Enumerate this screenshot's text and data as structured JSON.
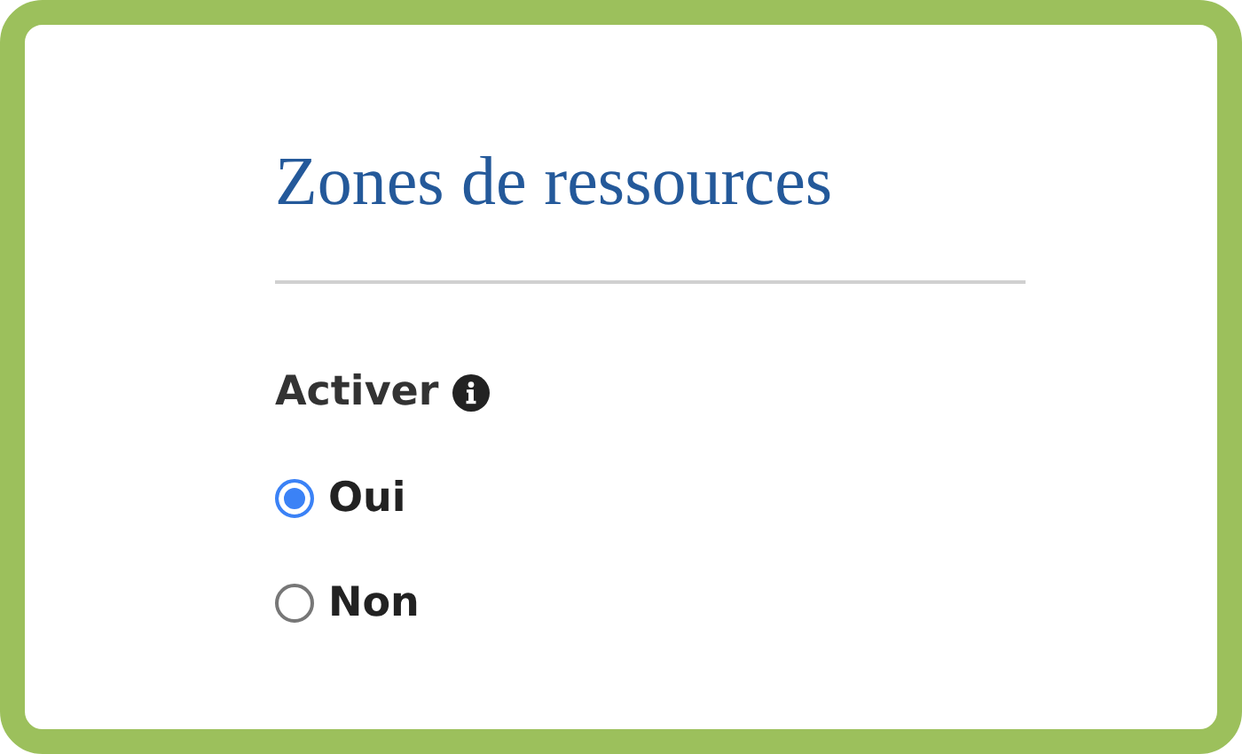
{
  "heading": "Zones de ressources",
  "field": {
    "label": "Activer",
    "info": true,
    "options": [
      {
        "label": "Oui",
        "selected": true
      },
      {
        "label": "Non",
        "selected": false
      }
    ]
  }
}
